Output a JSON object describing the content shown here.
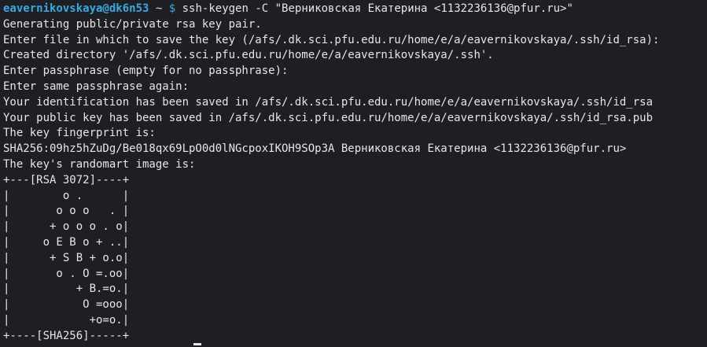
{
  "prompt": {
    "user_host": "eavernikovskaya@dk6n53",
    "path": "~",
    "symbol": "$",
    "command": "ssh-keygen -C \"Верниковская Екатерина <1132236136@pfur.ru>\""
  },
  "output_lines": [
    "Generating public/private rsa key pair.",
    "Enter file in which to save the key (/afs/.dk.sci.pfu.edu.ru/home/e/a/eavernikovskaya/.ssh/id_rsa):",
    "Created directory '/afs/.dk.sci.pfu.edu.ru/home/e/a/eavernikovskaya/.ssh'.",
    "Enter passphrase (empty for no passphrase):",
    "Enter same passphrase again:",
    "Your identification has been saved in /afs/.dk.sci.pfu.edu.ru/home/e/a/eavernikovskaya/.ssh/id_rsa",
    "Your public key has been saved in /afs/.dk.sci.pfu.edu.ru/home/e/a/eavernikovskaya/.ssh/id_rsa.pub",
    "The key fingerprint is:",
    "SHA256:09hz5hZuDg/Be018qx69LpO0d0lNGcpoxIKOH9SOp3A Верниковская Екатерина <1132236136@pfur.ru>",
    "The key's randomart image is:",
    "+---[RSA 3072]----+",
    "|        o .      |",
    "|       o o o   . |",
    "|      + o o o . o|",
    "|     o E B o + ..|",
    "|      + S B + o.o|",
    "|       o . O =.oo|",
    "|          + B.=o.|",
    "|           O =ooo|",
    "|            +o=o.|",
    "+----[SHA256]-----+"
  ],
  "colors": {
    "background": "#1e1f24",
    "text": "#e6e6e6",
    "prompt_user": "#3aa9e0"
  }
}
